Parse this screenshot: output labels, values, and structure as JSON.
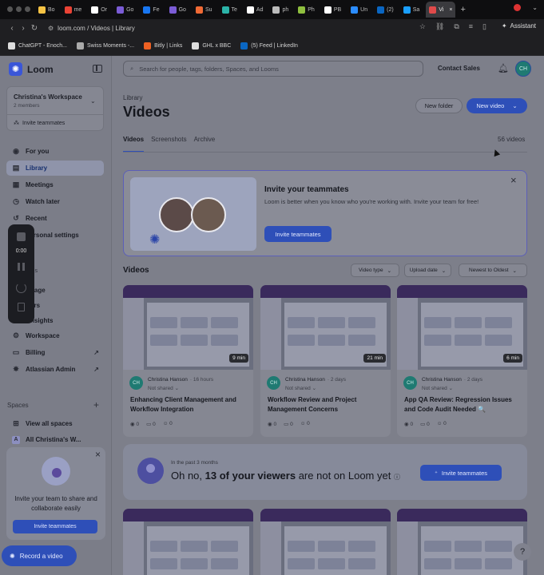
{
  "browser": {
    "tabs": [
      {
        "label": "Bo",
        "color": "#f6c344"
      },
      {
        "label": "me",
        "color": "#ea4335"
      },
      {
        "label": "Or",
        "color": "#ffffff"
      },
      {
        "label": "Go",
        "color": "#7b5cd6"
      },
      {
        "label": "Fe",
        "color": "#1877f2"
      },
      {
        "label": "Go",
        "color": "#7b5cd6"
      },
      {
        "label": "Su",
        "color": "#f06a35"
      },
      {
        "label": "Te",
        "color": "#2bb3a8"
      },
      {
        "label": "Ad",
        "color": "#ffffff"
      },
      {
        "label": "ph",
        "color": "#bbbbbb"
      },
      {
        "label": "Ph",
        "color": "#8fbf3f"
      },
      {
        "label": "PB",
        "color": "#ffffff"
      },
      {
        "label": "Un",
        "color": "#2b8cff"
      },
      {
        "label": "(2)",
        "color": "#0a66c2"
      },
      {
        "label": "Sa",
        "color": "#1a9fff"
      },
      {
        "label": "Vi",
        "color": "#e04a4a"
      }
    ],
    "new_tab": "+",
    "url": "loom.com / Videos | Library",
    "assistant": "Assistant",
    "bookmarks": [
      {
        "label": "ChatGPT - Enoch...",
        "color": "#dddddd"
      },
      {
        "label": "Swiss Moments -...",
        "color": "#aaaaaa"
      },
      {
        "label": "Bitly | Links",
        "color": "#ee6123"
      },
      {
        "label": "GHL x BBC",
        "color": "#dddddd"
      },
      {
        "label": "(5) Feed | LinkedIn",
        "color": "#0a66c2"
      }
    ]
  },
  "sidebar": {
    "logo": "Loom",
    "workspace": {
      "name": "Christina's Workspace",
      "members": "2 members",
      "invite": "Invite teammates"
    },
    "nav": [
      {
        "label": "For you",
        "icon": "user-circle-icon"
      },
      {
        "label": "Library",
        "icon": "library-icon",
        "active": true
      },
      {
        "label": "Meetings",
        "icon": "calendar-icon"
      },
      {
        "label": "Watch later",
        "icon": "clock-icon"
      },
      {
        "label": "Recent",
        "icon": "history-icon"
      },
      {
        "label": "Personal settings",
        "icon": "settings-icon"
      }
    ],
    "partial_items": [
      "ols",
      "nage",
      "ers",
      "nsights"
    ],
    "admin": [
      {
        "label": "Workspace",
        "icon": "gear-icon"
      },
      {
        "label": "Billing",
        "icon": "billing-icon",
        "external": true
      },
      {
        "label": "Atlassian Admin",
        "icon": "admin-icon",
        "external": true
      }
    ],
    "spaces_header": "Spaces",
    "spaces": [
      {
        "label": "View all spaces",
        "icon": "grid-icon"
      },
      {
        "label": "All Christina's W...",
        "icon": "letter-a-icon"
      }
    ],
    "invite_panel": {
      "text": "Invite your team to share and collaborate easily",
      "button": "Invite teammates"
    },
    "record_button": "Record a video"
  },
  "recorder": {
    "time": "0:00"
  },
  "header": {
    "search_placeholder": "Search for people, tags, folders, Spaces, and Looms",
    "contact_sales": "Contact Sales",
    "avatar": "CH"
  },
  "page": {
    "breadcrumb": "Library",
    "title": "Videos",
    "new_folder": "New folder",
    "new_video": "New video",
    "tabs": [
      "Videos",
      "Screenshots",
      "Archive"
    ],
    "count": "56 videos"
  },
  "banner": {
    "title": "Invite your teammates",
    "description": "Loom is better when you know who you're working with. Invite your team for free!",
    "button": "Invite teammates"
  },
  "videos_section": {
    "title": "Videos",
    "filters": [
      "Video type",
      "Upload date",
      "Newest to Oldest"
    ]
  },
  "videos": [
    {
      "duration": "9 min",
      "author": "Christina Hanson",
      "ago": "· 16 hours",
      "share": "Not shared",
      "title": "Enhancing Client Management and Workflow Integration",
      "views": "0",
      "comments": "0",
      "reactions": "0"
    },
    {
      "duration": "21 min",
      "author": "Christina Hanson",
      "ago": "· 2 days",
      "share": "Not shared",
      "title": "Workflow Review and Project Management Concerns",
      "views": "0",
      "comments": "0",
      "reactions": "0"
    },
    {
      "duration": "6 min",
      "author": "Christina Hanson",
      "ago": "· 2 days",
      "share": "Not shared",
      "title": "App QA Review: Regression Issues and Code Audit Needed 🔍",
      "views": "0",
      "comments": "0",
      "reactions": "0"
    }
  ],
  "viewers_banner": {
    "subtitle": "In the past 3 months",
    "prefix": "Oh no, ",
    "highlight": "13 of your viewers",
    "suffix": " are not on Loom yet",
    "button": "Invite teammates"
  },
  "help": "?"
}
